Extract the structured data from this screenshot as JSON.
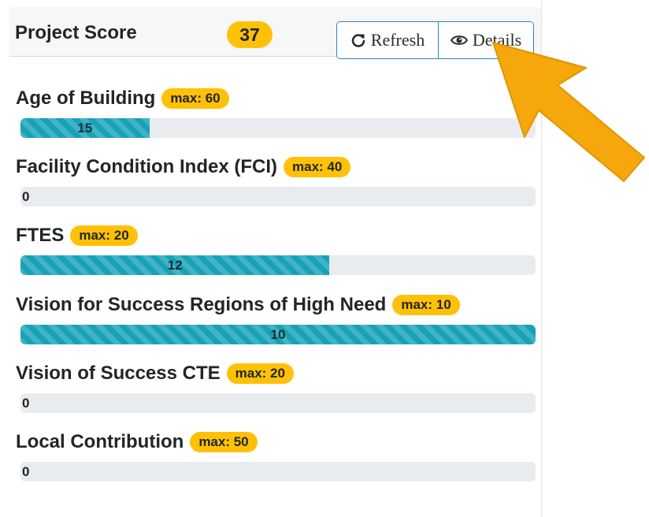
{
  "header": {
    "title": "Project Score",
    "score": "37",
    "refresh_label": "Refresh",
    "details_label": "Details"
  },
  "criteria": [
    {
      "label": "Age of Building",
      "max": "max: 60",
      "value": "15",
      "max_value": 60,
      "score": 15
    },
    {
      "label": "Facility Condition Index (FCI)",
      "max": "max: 40",
      "value": "0",
      "max_value": 40,
      "score": 0
    },
    {
      "label": "FTES",
      "max": "max: 20",
      "value": "12",
      "max_value": 20,
      "score": 12
    },
    {
      "label": "Vision for Success Regions of High Need",
      "max": "max: 10",
      "value": "10",
      "max_value": 10,
      "score": 10
    },
    {
      "label": "Vision of Success CTE",
      "max": "max: 20",
      "value": "0",
      "max_value": 20,
      "score": 0
    },
    {
      "label": "Local Contribution",
      "max": "max: 50",
      "value": "0",
      "max_value": 50,
      "score": 0
    }
  ],
  "colors": {
    "badge": "#ffc107",
    "progress_fill": "#17a2b8",
    "progress_track": "#e9ecef",
    "button_border": "#2a86c9",
    "arrow": "#f5a70c"
  },
  "icons": {
    "refresh": "refresh-icon",
    "details": "eye-icon",
    "pointer": "arrow-icon"
  }
}
